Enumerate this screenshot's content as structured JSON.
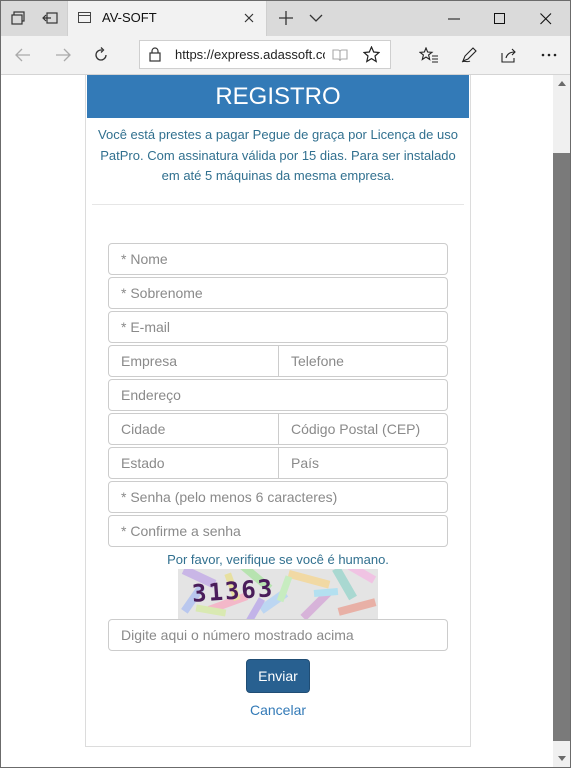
{
  "browser": {
    "tab_title": "AV-SOFT",
    "url": "https://express.adassoft.com"
  },
  "panel": {
    "header": "REGISTRO",
    "intro": "Você está prestes a pagar Pegue de graça por Licença de uso PatPro. Com assinatura válida por 15 dias. Para ser instalado em até 5 máquinas da mesma empresa."
  },
  "form": {
    "nome_placeholder": "* Nome",
    "sobrenome_placeholder": "* Sobrenome",
    "email_placeholder": "* E-mail",
    "empresa_placeholder": "Empresa",
    "telefone_placeholder": "Telefone",
    "endereco_placeholder": "Endereço",
    "cidade_placeholder": "Cidade",
    "cep_placeholder": "Código Postal (CEP)",
    "estado_placeholder": "Estado",
    "pais_placeholder": "País",
    "senha_placeholder": "* Senha (pelo menos 6 caracteres)",
    "confirme_placeholder": "* Confirme a senha",
    "human_check": "Por favor, verifique se você é humano.",
    "captcha_text": "31363",
    "captcha_input_placeholder": "Digite aqui o número mostrado acima",
    "submit_label": "Enviar",
    "cancel_label": "Cancelar"
  },
  "colors": {
    "primary": "#337ab7",
    "info_text": "#31708f",
    "button": "#286090"
  }
}
